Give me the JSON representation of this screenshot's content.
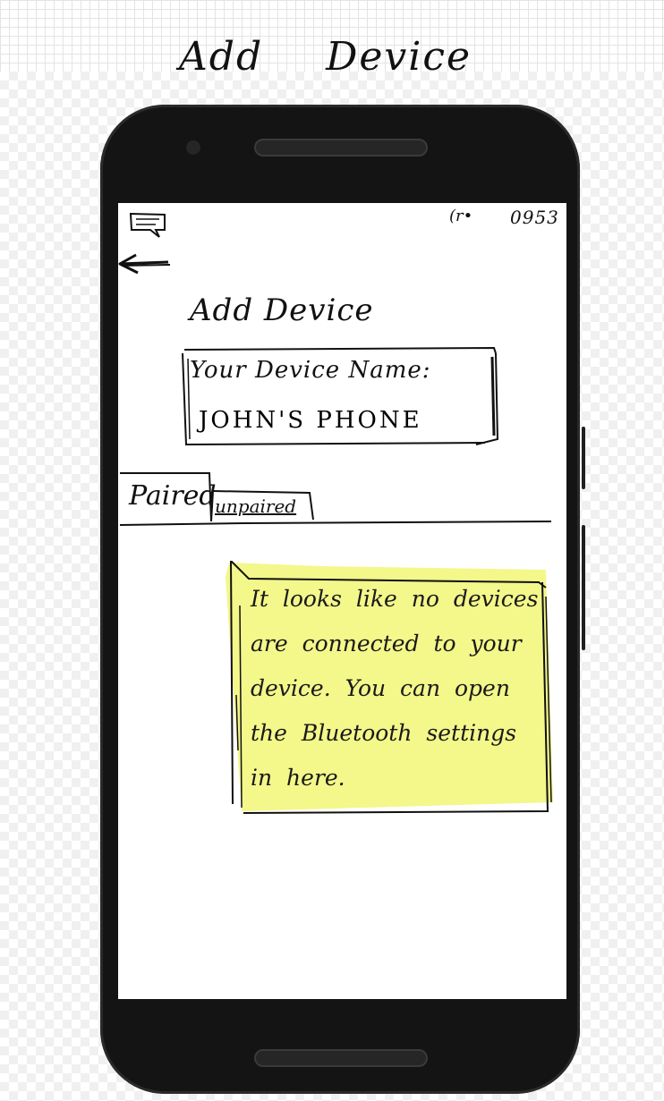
{
  "mockup": {
    "title_word1": "Add",
    "title_word2": "Device"
  },
  "status_bar": {
    "signal": "(r•",
    "time": "0953"
  },
  "icons": {
    "message": "message-icon",
    "back": "arrow-left-icon"
  },
  "screen": {
    "title": "Add Device"
  },
  "device_name": {
    "label": "Your Device Name:",
    "value": "JOHN'S PHONE"
  },
  "tabs": {
    "paired": "Paired",
    "unpaired": "unpaired"
  },
  "tip": {
    "text": "It looks like no devices are connected to your device. You can open the Bluetooth settings in here."
  },
  "colors": {
    "highlight": "#f4f78a",
    "phone_body": "#141414",
    "ink": "#111111"
  }
}
